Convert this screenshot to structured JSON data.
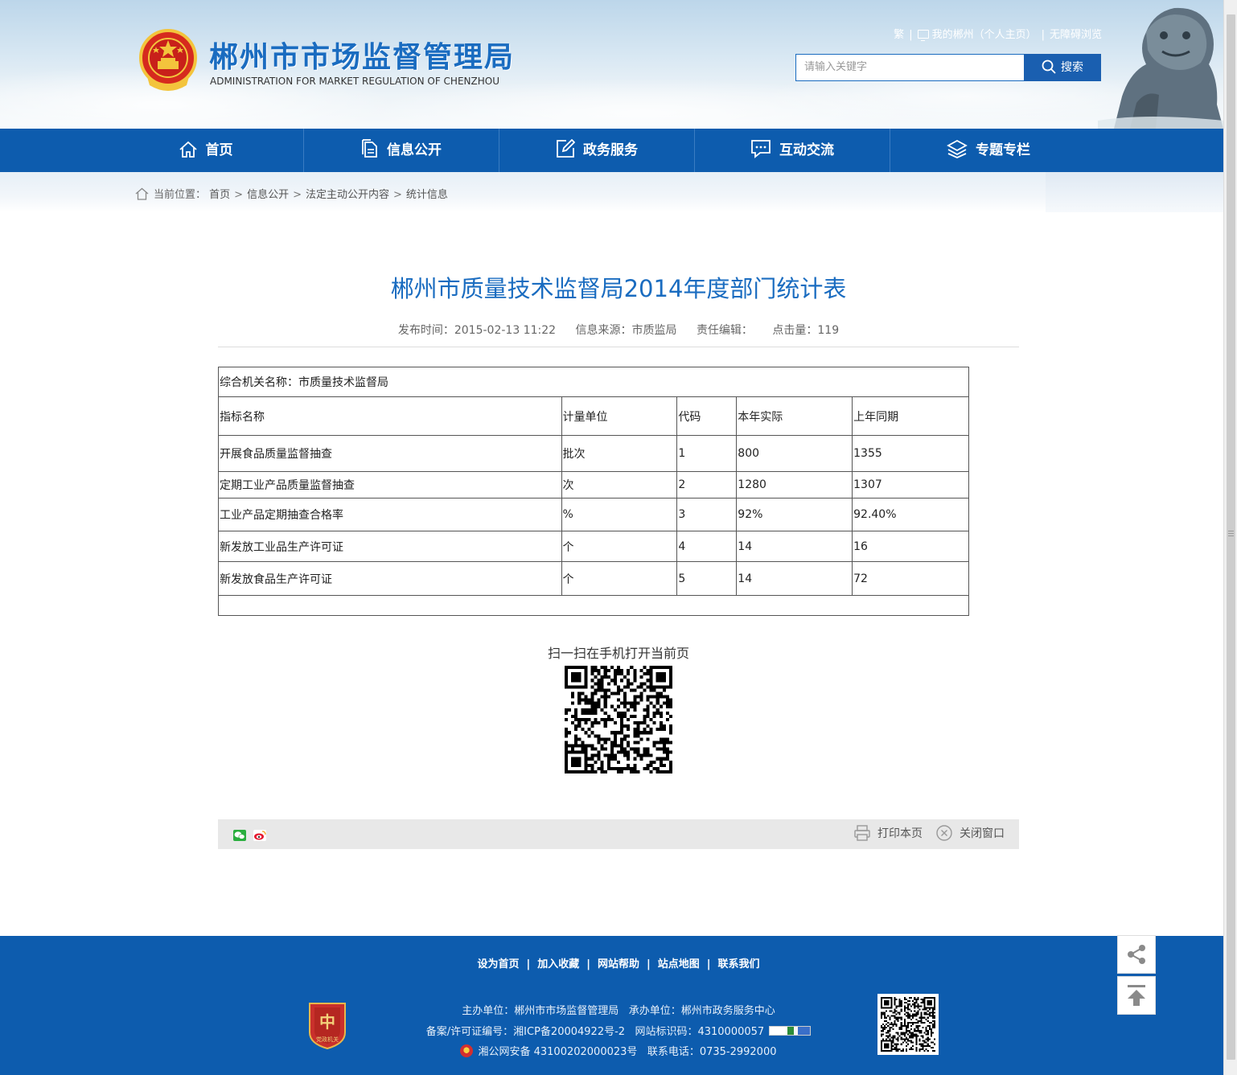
{
  "header": {
    "title": "郴州市市场监督管理局",
    "subtitle": "ADMINISTRATION FOR MARKET REGULATION OF CHENZHOU",
    "top_links": {
      "traditional": "繁",
      "my_chenzhou": "我的郴州（个人主页）",
      "accessibility": "无障碍浏览"
    },
    "search": {
      "placeholder": "请输入关键字",
      "button_label": "搜索"
    }
  },
  "nav": {
    "items": [
      {
        "label": "首页",
        "icon": "home-icon"
      },
      {
        "label": "信息公开",
        "icon": "document-icon"
      },
      {
        "label": "政务服务",
        "icon": "edit-icon"
      },
      {
        "label": "互动交流",
        "icon": "chat-icon"
      },
      {
        "label": "专题专栏",
        "icon": "layers-icon"
      }
    ]
  },
  "breadcrumb": {
    "prefix": "当前位置：",
    "items": [
      "首页",
      "信息公开",
      "法定主动公开内容",
      "统计信息"
    ]
  },
  "article": {
    "title": "郴州市质量技术监督局2014年度部门统计表",
    "meta": {
      "publish_label": "发布时间：",
      "publish_time": "2015-02-13 11:22",
      "source_label": "信息来源：",
      "source": "市质监局",
      "editor_label": "责任编辑：",
      "clicks_label": "点击量：",
      "clicks": "119"
    },
    "table": {
      "org_name": "综合机关名称：市质量技术监督局",
      "headers": [
        "指标名称",
        "计量单位",
        "代码",
        "本年实际",
        "上年同期"
      ],
      "rows": [
        [
          "开展食品质量监督抽查",
          "批次",
          "1",
          "800",
          "1355"
        ],
        [
          "定期工业产品质量监督抽查",
          "次",
          "2",
          "1280",
          "1307"
        ],
        [
          "工业产品定期抽查合格率",
          "%",
          "3",
          "92%",
          "92.40%"
        ],
        [
          "新发放工业品生产许可证",
          "个",
          "4",
          "14",
          "16"
        ],
        [
          "新发放食品生产许可证",
          "个",
          "5",
          "14",
          "72"
        ]
      ]
    },
    "qr_label": "扫一扫在手机打开当前页",
    "actions": {
      "print": "打印本页",
      "close": "关闭窗口"
    }
  },
  "footer": {
    "links": [
      "设为首页",
      "加入收藏",
      "网站帮助",
      "站点地图",
      "联系我们"
    ],
    "host": "主办单位：郴州市市场监督管理局",
    "undertaker": "承办单位：郴州市政务服务中心",
    "icp": "备案/许可证编号：湘ICP备20004922号-2",
    "site_id": "网站标识码：4310000057",
    "police": "湘公网安备 43100202000023号",
    "phone": "联系电话：0735-2992000",
    "badge_text": "党政机关"
  },
  "colors": {
    "brand_blue": "#0d5cae",
    "title_blue": "#1a6cc0"
  }
}
